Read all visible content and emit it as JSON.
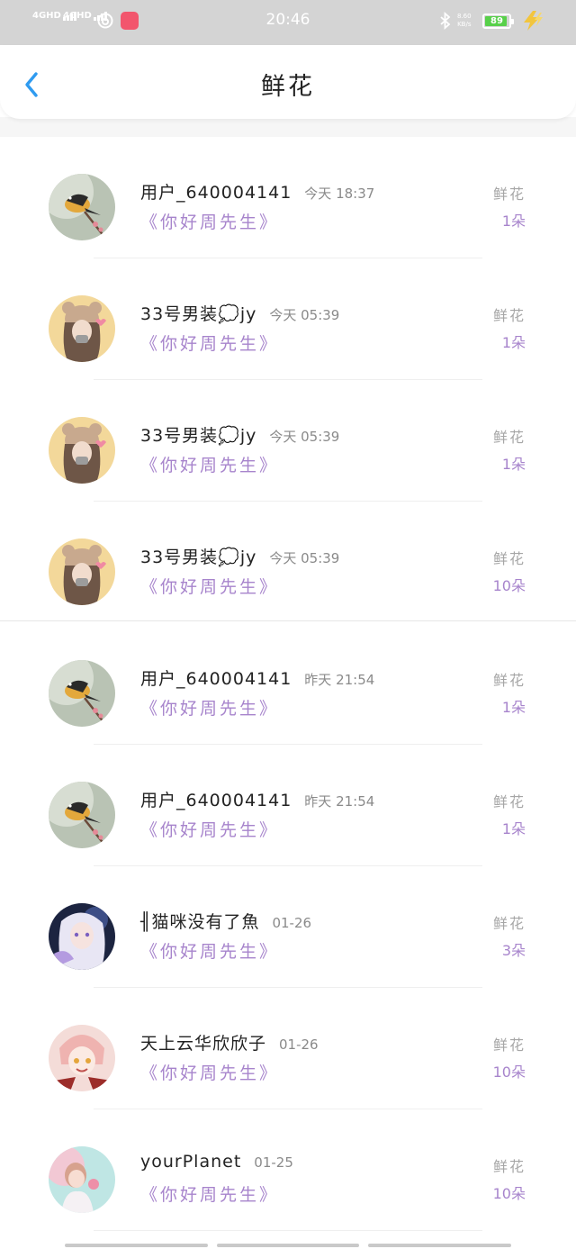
{
  "status_bar": {
    "network_1": "4GHD",
    "network_2": "4GHD",
    "time": "20:46",
    "speed_value": "8.60",
    "speed_unit": "KB/s",
    "battery": "89"
  },
  "header": {
    "title": "鲜花"
  },
  "colors": {
    "accent_blue": "#2f9bf0",
    "purple": "#a784cc",
    "battery_green": "#58d04a",
    "charge_yellow": "#f2c53d"
  },
  "items": [
    {
      "user": "用户_640004141",
      "time": "今天 18:37",
      "song": "《你好周先生》",
      "gift": "鲜花",
      "count": "1朵",
      "avatar": "bird-avatar"
    },
    {
      "user": "33号男装💭jy",
      "time": "今天 05:39",
      "song": "《你好周先生》",
      "gift": "鲜花",
      "count": "1朵",
      "avatar": "bear-girl-avatar"
    },
    {
      "user": "33号男装💭jy",
      "time": "今天 05:39",
      "song": "《你好周先生》",
      "gift": "鲜花",
      "count": "1朵",
      "avatar": "bear-girl-avatar"
    },
    {
      "user": "33号男装💭jy",
      "time": "今天 05:39",
      "song": "《你好周先生》",
      "gift": "鲜花",
      "count": "10朵",
      "avatar": "bear-girl-avatar"
    },
    {
      "user": "用户_640004141",
      "time": "昨天 21:54",
      "song": "《你好周先生》",
      "gift": "鲜花",
      "count": "1朵",
      "avatar": "bird-avatar"
    },
    {
      "user": "用户_640004141",
      "time": "昨天 21:54",
      "song": "《你好周先生》",
      "gift": "鲜花",
      "count": "1朵",
      "avatar": "bird-avatar"
    },
    {
      "user": "╢猫咪没有了魚",
      "time": "01-26",
      "song": "《你好周先生》",
      "gift": "鲜花",
      "count": "3朵",
      "avatar": "anime-girl-avatar"
    },
    {
      "user": "天上云华欣欣子",
      "time": "01-26",
      "song": "《你好周先生》",
      "gift": "鲜花",
      "count": "10朵",
      "avatar": "anime-boy-avatar"
    },
    {
      "user": "yourPlanet",
      "time": "01-25",
      "song": "《你好周先生》",
      "gift": "鲜花",
      "count": "10朵",
      "avatar": "pink-girl-avatar"
    }
  ]
}
